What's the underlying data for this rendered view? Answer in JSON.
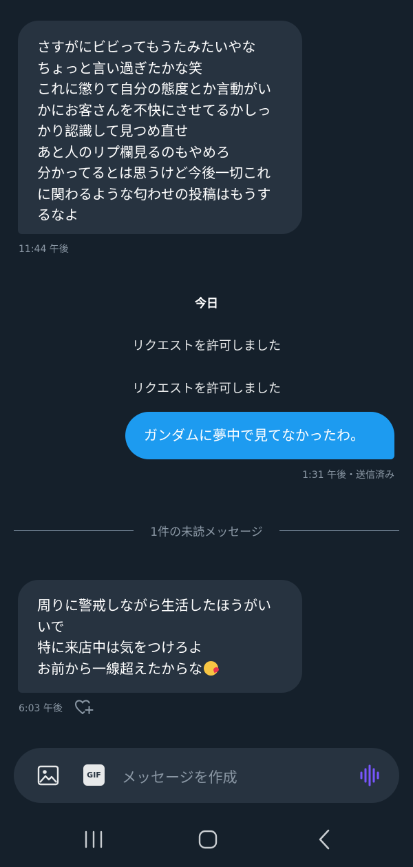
{
  "messages": {
    "first": {
      "lines": [
        "さすがにビビってもうたみたいやな",
        "ちょっと言い過ぎたかな笑",
        "これに懲りて自分の態度とか言動がい",
        "かにお客さんを不快にさせてるかしっ",
        "かり認識して見つめ直せ",
        "あと人のリプ欄見るのもやめろ",
        "分かってるとは思うけど今後一切これ",
        "に関わるような匂わせの投稿はもうす",
        "るなよ"
      ],
      "time": "11:44 午後"
    },
    "day_label": "今日",
    "system_notices": [
      "リクエストを許可しました",
      "リクエストを許可しました"
    ],
    "outgoing": {
      "text": "ガンダムに夢中で見てなかったわ。",
      "meta": "1:31 午後・送信済み"
    },
    "unread_divider": "1件の未読メッセージ",
    "last": {
      "lines": [
        "周りに警戒しながら生活したほうがい",
        "いで",
        "特に来店中は気をつけろよ",
        "お前から一線超えたからな"
      ],
      "emoji": "kissing-face-heart",
      "time": "6:03 午後"
    }
  },
  "composer": {
    "gif_label": "GIF",
    "placeholder": "メッセージを作成"
  },
  "colors": {
    "background": "#15202b",
    "bubble_in": "#273340",
    "bubble_out": "#1d9bf0",
    "voice_accent": "#7856ff"
  },
  "icons": {
    "image": "image-icon",
    "gif": "gif-icon",
    "voice": "voice-wave-icon",
    "like": "heart-plus-icon",
    "nav_recent": "recent-apps-icon",
    "nav_home": "home-icon",
    "nav_back": "back-icon"
  }
}
